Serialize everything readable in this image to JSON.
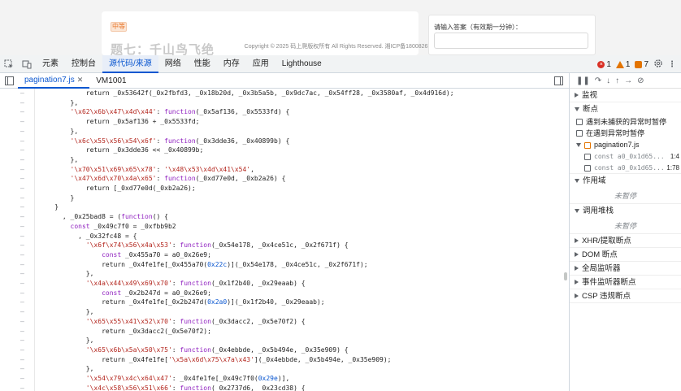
{
  "page": {
    "tag": "中等",
    "title": "题七：千山鸟飞绝",
    "footer": "Copyright © 2025 码上爬版权所有 All Rights Reserved. 湘ICP备18008267号",
    "answer_label": "请输入答案（有效期一分钟）："
  },
  "devtools": {
    "tabs": [
      "元素",
      "控制台",
      "源代码/来源",
      "网络",
      "性能",
      "内存",
      "应用",
      "Lighthouse"
    ],
    "active_tab": "源代码/来源",
    "errors": "1",
    "warnings": "1",
    "infos": "7"
  },
  "files": {
    "tabs": [
      "pagination7.js",
      "VM1001"
    ]
  },
  "code": [
    {
      "parts": [
        [
          "n",
          "            return _0x53642f(_0x2fbfd3, _0x18b20d, _0x3b5a5b, _0x9dc7ac, _0x54ff28, _0x3580af, _0x4d916d);"
        ]
      ]
    },
    {
      "parts": [
        [
          "n",
          "        },"
        ]
      ]
    },
    {
      "parts": [
        [
          "s",
          "        '\\x62\\x6b\\x47\\x4d\\x44'"
        ],
        [
          "n",
          ": "
        ],
        [
          "k",
          "function"
        ],
        [
          "n",
          "(_0x5af136, _0x5533fd) {"
        ]
      ]
    },
    {
      "parts": [
        [
          "n",
          "            return _0x5af136 + _0x5533fd;"
        ]
      ]
    },
    {
      "parts": [
        [
          "n",
          "        },"
        ]
      ]
    },
    {
      "parts": [
        [
          "s",
          "        '\\x6c\\x55\\x56\\x54\\x6f'"
        ],
        [
          "n",
          ": "
        ],
        [
          "k",
          "function"
        ],
        [
          "n",
          "(_0x3dde36, _0x40899b) {"
        ]
      ]
    },
    {
      "parts": [
        [
          "n",
          "            return _0x3dde36 << _0x40899b;"
        ]
      ]
    },
    {
      "parts": [
        [
          "n",
          "        },"
        ]
      ]
    },
    {
      "parts": [
        [
          "s",
          "        '\\x70\\x51\\x69\\x65\\x78'"
        ],
        [
          "n",
          ": "
        ],
        [
          "s",
          "'\\x48\\x53\\x4d\\x41\\x54'"
        ],
        [
          "n",
          ","
        ]
      ]
    },
    {
      "parts": [
        [
          "s",
          "        '\\x47\\x6d\\x70\\x4a\\x65'"
        ],
        [
          "n",
          ": "
        ],
        [
          "k",
          "function"
        ],
        [
          "n",
          "(_0xd77e0d, _0xb2a26) {"
        ]
      ]
    },
    {
      "parts": [
        [
          "n",
          "            return [_0xd77e0d(_0xb2a26);"
        ]
      ]
    },
    {
      "parts": [
        [
          "n",
          "        }"
        ]
      ]
    },
    {
      "parts": [
        [
          "n",
          "    }"
        ]
      ]
    },
    {
      "parts": [
        [
          "n",
          "      , _0x25bad8 = ("
        ],
        [
          "k",
          "function"
        ],
        [
          "n",
          "() {"
        ]
      ]
    },
    {
      "parts": [
        [
          "k",
          "        const"
        ],
        [
          "n",
          " _0x49c7f0 = _0xfbb9b2"
        ]
      ]
    },
    {
      "parts": [
        [
          "n",
          "          , _0x32fc48 = {"
        ]
      ]
    },
    {
      "parts": [
        [
          "s",
          "            '\\x6f\\x74\\x56\\x4a\\x53'"
        ],
        [
          "n",
          ": "
        ],
        [
          "k",
          "function"
        ],
        [
          "n",
          "(_0x54e178, _0x4ce51c, _0x2f671f) {"
        ]
      ]
    },
    {
      "parts": [
        [
          "k",
          "                const"
        ],
        [
          "n",
          " _0x455a70 = a0_0x26e9;"
        ]
      ]
    },
    {
      "parts": [
        [
          "n",
          "                return _0x4fe1fe[_0x455a70("
        ],
        [
          "num",
          "0x22c"
        ],
        [
          "n",
          ")](_0x54e178, _0x4ce51c, _0x2f671f);"
        ]
      ]
    },
    {
      "parts": [
        [
          "n",
          "            },"
        ]
      ]
    },
    {
      "parts": [
        [
          "s",
          "            '\\x4a\\x44\\x49\\x69\\x70'"
        ],
        [
          "n",
          ": "
        ],
        [
          "k",
          "function"
        ],
        [
          "n",
          "(_0x1f2b40, _0x29eaab) {"
        ]
      ]
    },
    {
      "parts": [
        [
          "k",
          "                const"
        ],
        [
          "n",
          " _0x2b247d = a0_0x26e9;"
        ]
      ]
    },
    {
      "parts": [
        [
          "n",
          "                return _0x4fe1fe[_0x2b247d("
        ],
        [
          "num",
          "0x2a0"
        ],
        [
          "n",
          ")](_0x1f2b40, _0x29eaab);"
        ]
      ]
    },
    {
      "parts": [
        [
          "n",
          "            },"
        ]
      ]
    },
    {
      "parts": [
        [
          "s",
          "            '\\x65\\x55\\x41\\x52\\x70'"
        ],
        [
          "n",
          ": "
        ],
        [
          "k",
          "function"
        ],
        [
          "n",
          "(_0x3dacc2, _0x5e70f2) {"
        ]
      ]
    },
    {
      "parts": [
        [
          "n",
          "                return _0x3dacc2(_0x5e70f2);"
        ]
      ]
    },
    {
      "parts": [
        [
          "n",
          "            },"
        ]
      ]
    },
    {
      "parts": [
        [
          "s",
          "            '\\x65\\x6b\\x5a\\x50\\x75'"
        ],
        [
          "n",
          ": "
        ],
        [
          "k",
          "function"
        ],
        [
          "n",
          "(_0x4ebbde, _0x5b494e, _0x35e909) {"
        ]
      ]
    },
    {
      "parts": [
        [
          "n",
          "                return _0x4fe1fe["
        ],
        [
          "s",
          "'\\x5a\\x6d\\x75\\x7a\\x43'"
        ],
        [
          "n",
          "](_0x4ebbde, _0x5b494e, _0x35e909);"
        ]
      ]
    },
    {
      "parts": [
        [
          "n",
          "            },"
        ]
      ]
    },
    {
      "parts": [
        [
          "s",
          "            '\\x54\\x79\\x4c\\x64\\x47'"
        ],
        [
          "n",
          ": _0x4fe1fe[_0x49c7f0("
        ],
        [
          "num",
          "0x29e"
        ],
        [
          "n",
          ")],"
        ]
      ]
    },
    {
      "parts": [
        [
          "s",
          "            '\\x4c\\x58\\x56\\x51\\x66'"
        ],
        [
          "n",
          ": "
        ],
        [
          "k",
          "function"
        ],
        [
          "n",
          "(_0x2737d6, _0x23cd38) {"
        ]
      ]
    }
  ],
  "sidebar": {
    "watch": "监视",
    "breakpoints": "断点",
    "pause_uncaught": "遇到未捕获的异常时暂停",
    "pause_caught": "在遇到异常时暂停",
    "bp_file": "pagination7.js",
    "bp_items": [
      {
        "code": "const a0_0x1d65...",
        "line": "1:4"
      },
      {
        "code": "const a0_0x1d65...",
        "line": "1:78"
      }
    ],
    "scope": "作用域",
    "not_paused": "未暂停",
    "call_stack": "调用堆栈",
    "not_paused2": "未暂停",
    "sections": [
      "XHR/提取断点",
      "DOM 断点",
      "全局监听器",
      "事件监听器断点",
      "CSP 违规断点"
    ]
  }
}
